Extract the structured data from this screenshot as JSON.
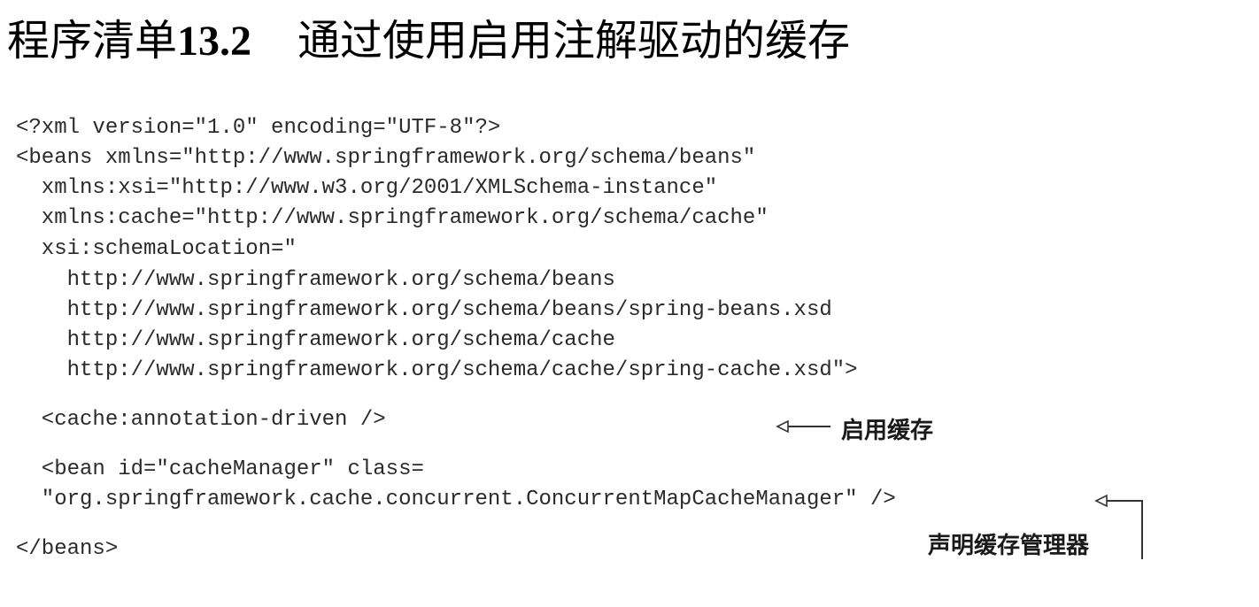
{
  "title": {
    "listing_label": "程序清单",
    "listing_number": "13.2",
    "caption": "通过使用启用注解驱动的缓存"
  },
  "code": {
    "lines": [
      "<?xml version=\"1.0\" encoding=\"UTF-8\"?>",
      "<beans xmlns=\"http://www.springframework.org/schema/beans\"",
      "  xmlns:xsi=\"http://www.w3.org/2001/XMLSchema-instance\"",
      "  xmlns:cache=\"http://www.springframework.org/schema/cache\"",
      "  xsi:schemaLocation=\"",
      "    http://www.springframework.org/schema/beans",
      "    http://www.springframework.org/schema/beans/spring-beans.xsd",
      "    http://www.springframework.org/schema/cache",
      "    http://www.springframework.org/schema/cache/spring-cache.xsd\">",
      "  <cache:annotation-driven />",
      "  <bean id=\"cacheManager\" class=",
      "  \"org.springframework.cache.concurrent.ConcurrentMapCacheManager\" />",
      "</beans>"
    ]
  },
  "annotations": {
    "enable_cache": "启用缓存",
    "declare_cache_manager": "声明缓存管理器"
  }
}
